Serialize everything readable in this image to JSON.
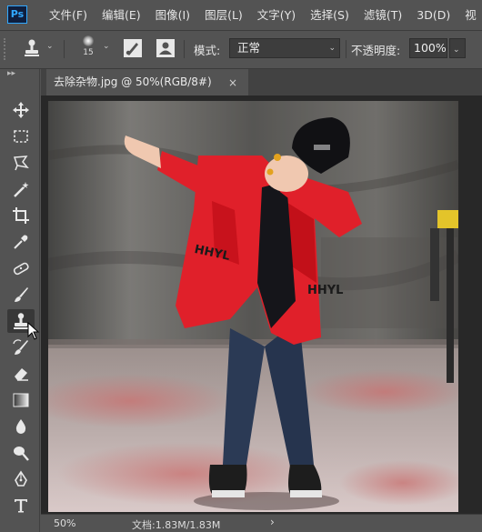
{
  "app": {
    "logo_text": "Ps"
  },
  "menu": [
    "文件(F)",
    "编辑(E)",
    "图像(I)",
    "图层(L)",
    "文字(Y)",
    "选择(S)",
    "滤镜(T)",
    "3D(D)",
    "视"
  ],
  "options": {
    "brush_size": "15",
    "mode_label": "模式:",
    "mode_value": "正常",
    "opacity_label": "不透明度:",
    "opacity_value": "100%"
  },
  "document": {
    "tab_title": "去除杂物.jpg @ 50%(RGB/8#)",
    "close_glyph": "×",
    "photo_text": "HHYL"
  },
  "status": {
    "zoom": "50%",
    "doc_info": "文档:1.83M/1.83M",
    "arrow": "›"
  },
  "tools": [
    "move-tool",
    "marquee-tool",
    "lasso-tool",
    "magic-wand-tool",
    "crop-tool",
    "eyedropper-tool",
    "healing-tool",
    "brush-tool",
    "clone-stamp-tool",
    "history-brush-tool",
    "eraser-tool",
    "gradient-tool",
    "blur-tool",
    "dodge-tool",
    "pen-tool",
    "type-tool"
  ],
  "colors": {
    "jacket": "#e0202a",
    "ui_bg": "#535353",
    "canvas_bg": "#282828"
  }
}
